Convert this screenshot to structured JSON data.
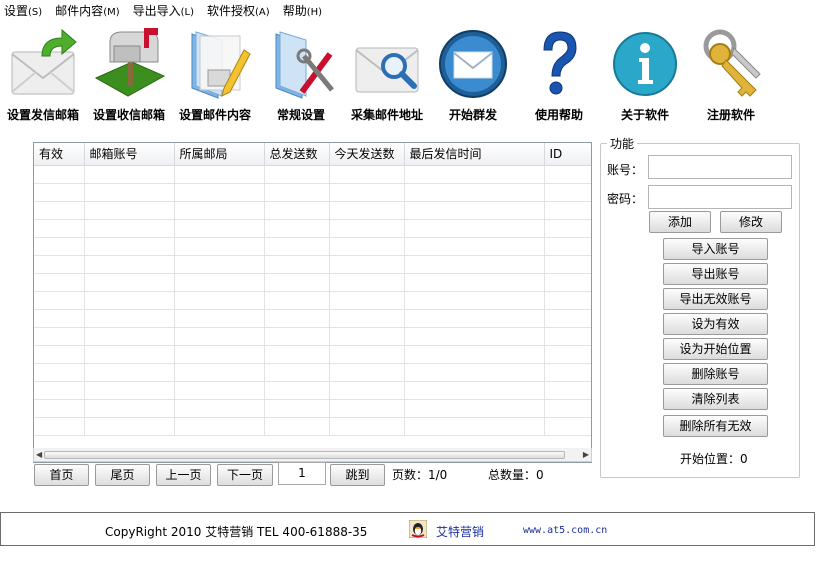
{
  "menu": [
    {
      "label": "设置",
      "accel": "(S)"
    },
    {
      "label": "邮件内容",
      "accel": "(M)"
    },
    {
      "label": "导出导入",
      "accel": "(L)"
    },
    {
      "label": "软件授权",
      "accel": "(A)"
    },
    {
      "label": "帮助",
      "accel": "(H)"
    }
  ],
  "toolbar": [
    {
      "label": "设置发信邮箱",
      "icon": "envelope-send-icon"
    },
    {
      "label": "设置收信邮箱",
      "icon": "mailbox-icon"
    },
    {
      "label": "设置邮件内容",
      "icon": "folder-pencil-icon"
    },
    {
      "label": "常规设置",
      "icon": "folder-tools-icon"
    },
    {
      "label": "采集邮件地址",
      "icon": "envelope-search-icon"
    },
    {
      "label": "开始群发",
      "icon": "mail-round-icon"
    },
    {
      "label": "使用帮助",
      "icon": "question-icon"
    },
    {
      "label": "关于软件",
      "icon": "info-icon"
    },
    {
      "label": "注册软件",
      "icon": "keys-icon"
    }
  ],
  "table": {
    "columns": [
      "有效",
      "邮箱账号",
      "所属邮局",
      "总发送数",
      "今天发送数",
      "最后发信时间",
      "ID"
    ],
    "rows": []
  },
  "pager": {
    "first": "首页",
    "last": "尾页",
    "prev": "上一页",
    "next": "下一页",
    "page_value": "1",
    "jump": "跳到",
    "pages_text": "页数：1/0",
    "total_text": "总数量：0"
  },
  "panel": {
    "title": "功能",
    "account_label": "账号：",
    "password_label": "密码：",
    "account_value": "",
    "password_value": "",
    "add": "添加",
    "edit": "修改",
    "actions": [
      "导入账号",
      "导出账号",
      "导出无效账号",
      "设为有效",
      "设为开始位置",
      "删除账号",
      "清除列表",
      "删除所有无效"
    ],
    "start_text": "开始位置：0"
  },
  "footer": {
    "copyright": "CopyRight 2010 艾特营销 TEL 400-61888-35",
    "brand": "艾特营销",
    "site": "www.at5.com.cn"
  },
  "colors": {
    "footer_link": "#1a2f9c",
    "help_blue": "#1a55b0",
    "info_teal": "#2aa7c9",
    "mailbox_red": "#c8102e",
    "grass_green": "#3c8f1e",
    "key_gold": "#e0b43a"
  }
}
